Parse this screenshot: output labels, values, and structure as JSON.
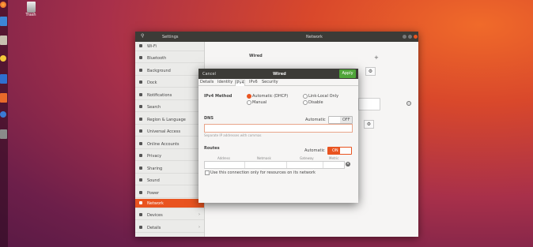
{
  "desktop": {
    "trash_label": "Trash"
  },
  "settings_window": {
    "title": "Settings",
    "panel_title": "Network",
    "sidebar": {
      "items": [
        {
          "label": "Wi-Fi",
          "icon": "wifi-icon"
        },
        {
          "label": "Bluetooth",
          "icon": "bluetooth-icon"
        },
        {
          "label": "Background",
          "icon": "background-icon"
        },
        {
          "label": "Dock",
          "icon": "dock-icon"
        },
        {
          "label": "Notifications",
          "icon": "notifications-icon"
        },
        {
          "label": "Search",
          "icon": "search-icon"
        },
        {
          "label": "Region & Language",
          "icon": "region-icon"
        },
        {
          "label": "Universal Access",
          "icon": "accessibility-icon"
        },
        {
          "label": "Online Accounts",
          "icon": "online-accounts-icon"
        },
        {
          "label": "Privacy",
          "icon": "privacy-icon"
        },
        {
          "label": "Sharing",
          "icon": "sharing-icon"
        },
        {
          "label": "Sound",
          "icon": "sound-icon"
        },
        {
          "label": "Power",
          "icon": "power-icon"
        },
        {
          "label": "Network",
          "icon": "network-icon",
          "active": true
        },
        {
          "label": "Devices",
          "icon": "devices-icon"
        },
        {
          "label": "Details",
          "icon": "details-icon"
        }
      ]
    },
    "wired_section": "Wired",
    "add_symbol": "+"
  },
  "dialog": {
    "cancel_label": "Cancel",
    "title": "Wired",
    "apply_label": "Apply",
    "tabs": [
      {
        "label": "Details"
      },
      {
        "label": "Identity"
      },
      {
        "label": "IPv4",
        "active": true
      },
      {
        "label": "IPv6"
      },
      {
        "label": "Security"
      }
    ],
    "ipv4_method_label": "IPv4 Method",
    "methods": {
      "automatic": "Automatic (DHCP)",
      "manual": "Manual",
      "link_local": "Link-Local Only",
      "disable": "Disable",
      "selected": "Automatic (DHCP)"
    },
    "dns": {
      "label": "DNS",
      "automatic_label": "Automatic",
      "toggle_state": "OFF",
      "value": "",
      "hint": "Separate IP addresses with commas"
    },
    "routes": {
      "label": "Routes",
      "automatic_label": "Automatic",
      "toggle_state": "ON",
      "columns": [
        "Address",
        "Netmask",
        "Gateway",
        "Metric"
      ],
      "only_resources_label": "Use this connection only for resources on its network"
    }
  },
  "colors": {
    "accent": "#e95420",
    "apply": "#4fa53a",
    "titlebar": "#3c3b37"
  }
}
